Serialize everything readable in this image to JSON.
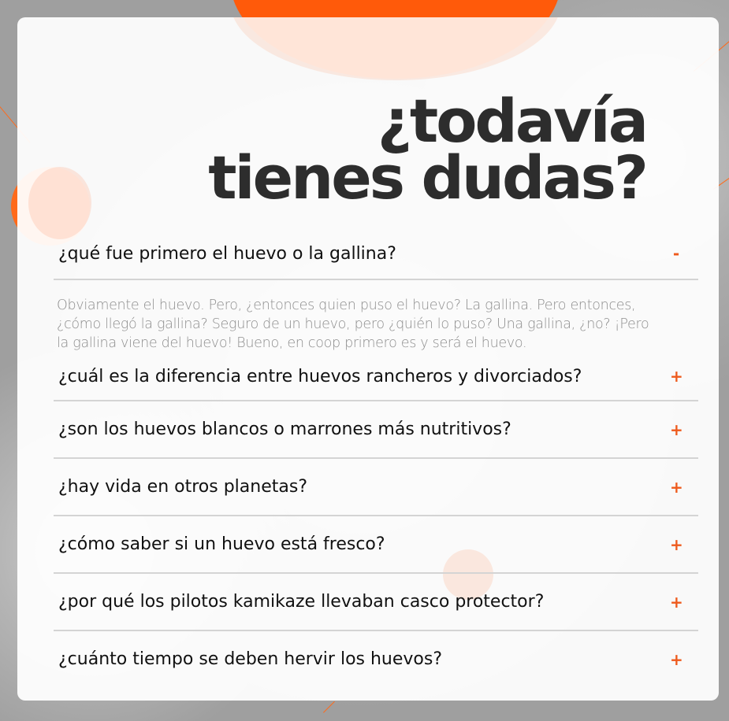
{
  "title": {
    "line1": "¿todavía",
    "line2": "tienes dudas?"
  },
  "faq": [
    {
      "question": "¿qué fue primero el huevo o la gallina?",
      "toggle": "-",
      "answer": "Obviamente el huevo. Pero, ¿entonces quien puso el huevo? La gallina. Pero entonces, ¿cómo llegó la gallina? Seguro de un huevo, pero ¿quién lo puso? Una gallina, ¿no? ¡Pero la gallina viene del huevo! Bueno, en coop primero es y será el huevo."
    },
    {
      "question": "¿cuál es la diferencia entre huevos rancheros y divorciados?",
      "toggle": "+"
    },
    {
      "question": "¿son los huevos blancos o marrones más nutritivos?",
      "toggle": "+"
    },
    {
      "question": "¿hay vida en otros planetas?",
      "toggle": "+"
    },
    {
      "question": "¿cómo saber si un huevo está fresco?",
      "toggle": "+"
    },
    {
      "question": "¿por qué los pilotos kamikaze llevaban casco protector?",
      "toggle": "+"
    },
    {
      "question": "¿cuánto tiempo se deben hervir los huevos?",
      "toggle": "+"
    }
  ],
  "colors": {
    "accent": "#ee5a1c",
    "title": "#2d2d2d",
    "question": "#111111",
    "answer": "#8e8e8e",
    "divider": "#d4d4d4"
  }
}
